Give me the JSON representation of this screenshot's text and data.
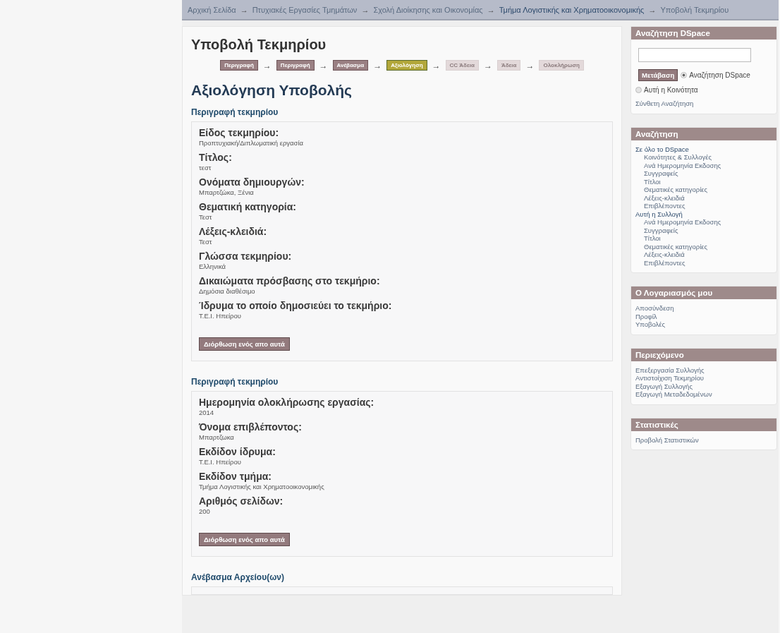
{
  "breadcrumb": {
    "separator": "→",
    "items": [
      {
        "label": "Αρχική Σελίδα",
        "current": false
      },
      {
        "label": "Πτυχιακές Εργασίες Τμημάτων",
        "current": false
      },
      {
        "label": "Σχολή Διοίκησης και Οικονομίας",
        "current": false
      },
      {
        "label": "Τμήμα Λογιστικής και Χρηματοοικονομικής",
        "current": true
      },
      {
        "label": "Υποβολή Τεκμηρίου",
        "current": false
      }
    ]
  },
  "page_title": "Υποβολή Τεκμηρίου",
  "progress": {
    "separator": "→",
    "steps": [
      {
        "label": "Περιγραφή",
        "selected": false,
        "disabled": false
      },
      {
        "label": "Περιγραφή",
        "selected": false,
        "disabled": false
      },
      {
        "label": "Ανέβασμα",
        "selected": false,
        "disabled": false
      },
      {
        "label": "Αξιολόγηση",
        "selected": true,
        "disabled": false
      },
      {
        "label": "CC Άδεια",
        "selected": false,
        "disabled": true
      },
      {
        "label": "Άδεια",
        "selected": false,
        "disabled": true
      },
      {
        "label": "Ολοκλήρωση",
        "selected": false,
        "disabled": true
      }
    ]
  },
  "heading": "Αξιολόγηση Υποβολής",
  "sections": [
    {
      "title": "Περιγραφή τεκμηρίου",
      "fields": [
        {
          "label": "Είδος τεκμηρίου:",
          "value": "Προπτυχιακή/Διπλωματική εργασία"
        },
        {
          "label": "Τίτλος:",
          "value": "τεστ"
        },
        {
          "label": "Ονόματα δημιουργών:",
          "value": "Μπαρτζώκα, Ξένια"
        },
        {
          "label": "Θεματική κατηγορία:",
          "value": "Τεστ"
        },
        {
          "label": "Λέξεις-κλειδιά:",
          "value": "Τεστ"
        },
        {
          "label": "Γλώσσα τεκμηρίου:",
          "value": "Ελληνικά"
        },
        {
          "label": "Δικαιώματα πρόσβασης στο τεκμήριο:",
          "value": "Δημόσια διαθέσιμο"
        },
        {
          "label": "Ίδρυμα το οποίο δημοσιεύει το τεκμήριο:",
          "value": "Τ.Ε.Ι. Ηπείρου"
        }
      ],
      "button": "Διόρθωση ενός απο αυτά"
    },
    {
      "title": "Περιγραφή τεκμηρίου",
      "fields": [
        {
          "label": "Ημερομηνία ολοκλήρωσης εργασίας:",
          "value": "2014"
        },
        {
          "label": "Όνομα επιβλέποντος:",
          "value": "Μπαρτζωκα"
        },
        {
          "label": "Εκδίδον ίδρυμα:",
          "value": "Τ.Ε.Ι. Ηπείρου"
        },
        {
          "label": "Εκδίδον τμήμα:",
          "value": "Τμήμα Λογιστικής και Χρηματοοικονομικής"
        },
        {
          "label": "Αριθμός σελίδων:",
          "value": "200"
        }
      ],
      "button": "Διόρθωση ενός απο αυτά"
    },
    {
      "title": "Ανέβασμα Αρχείου(ων)"
    }
  ],
  "sidebar": [
    {
      "kind": "search",
      "title": "Αναζήτηση DSpace",
      "button": "Μετάβαση",
      "options": [
        {
          "label": "Αναζήτηση DSpace",
          "selected": true
        },
        {
          "label": "Αυτή η Κοινότητα",
          "selected": false
        }
      ],
      "link": "Σύνθετη Αναζήτηση"
    },
    {
      "kind": "tree",
      "title": "Αναζήτηση",
      "items": [
        {
          "label": "Σε όλο το DSpace",
          "children": [
            {
              "label": "Κοινότητες & Συλλογές"
            },
            {
              "label": "Ανά Ημερομηνία Εκδοσης"
            },
            {
              "label": "Συγγραφείς"
            },
            {
              "label": "Τίτλοι"
            },
            {
              "label": "Θεματικές κατηγορίες"
            },
            {
              "label": "Λέξεις-κλειδιά"
            },
            {
              "label": "Επιβλέποντες"
            }
          ]
        },
        {
          "label": "Αυτή η Συλλογή",
          "children": [
            {
              "label": "Ανά Ημερομηνία Εκδοσης"
            },
            {
              "label": "Συγγραφείς"
            },
            {
              "label": "Τίτλοι"
            },
            {
              "label": "Θεματικές κατηγορίες"
            },
            {
              "label": "Λέξεις-κλειδιά"
            },
            {
              "label": "Επιβλέποντες"
            }
          ]
        }
      ]
    },
    {
      "kind": "links",
      "title": "Ο Λογαριασμός μου",
      "items": [
        {
          "label": "Αποσύνδεση"
        },
        {
          "label": "Προφίλ"
        },
        {
          "label": "Υποβολές"
        }
      ]
    },
    {
      "kind": "links",
      "title": "Περιεχόμενο",
      "items": [
        {
          "label": "Επεξεργασία Συλλογής"
        },
        {
          "label": "Αντιστοίχιση Τεκμηρίου"
        },
        {
          "label": "Εξαγωγή Συλλογής"
        },
        {
          "label": "Εξαγωγή Μεταδεδομένων"
        }
      ]
    },
    {
      "kind": "links",
      "title": "Στατιστικές",
      "items": [
        {
          "label": "Προβολή Στατιστικών"
        }
      ]
    }
  ]
}
